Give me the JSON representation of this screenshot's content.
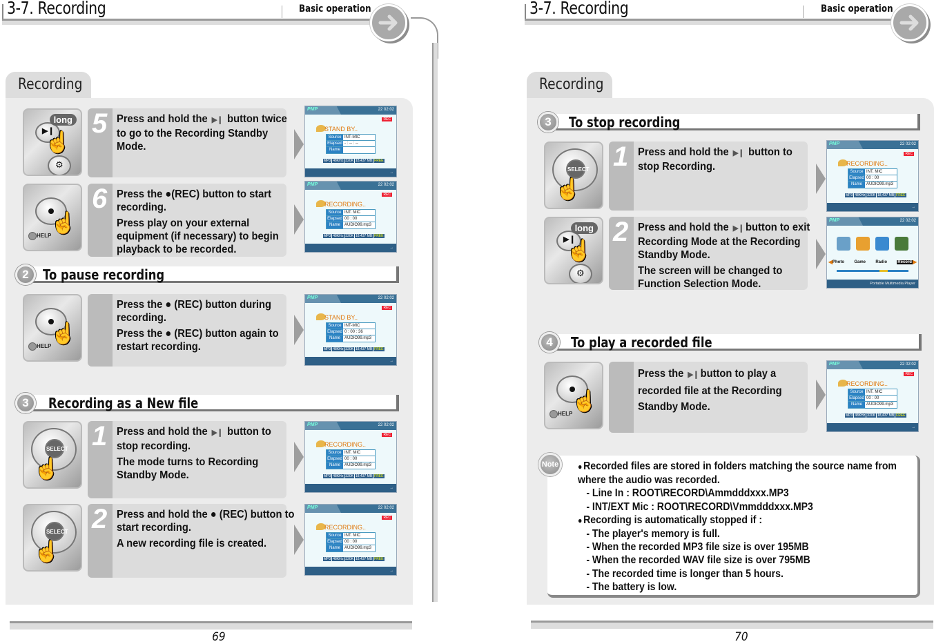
{
  "left_page": {
    "header": {
      "title": "3-7. Recording",
      "section": "Basic operation"
    },
    "tab_label": "Recording",
    "steps_top": [
      {
        "number": "5",
        "device": "play-button-long",
        "device_badge": "long",
        "lines": [
          {
            "pre": "Press and hold the",
            "icon": "play-pause-icon",
            "post": "button twice to go to the Recording Standby Mode."
          }
        ],
        "screen": "standby-empty"
      },
      {
        "number": "6",
        "device": "rec-button",
        "lines": [
          {
            "pre": "Press the",
            "icon": "rec-dot-icon",
            "post": "(REC) button to start recording."
          },
          {
            "pre": "Press play on your external equipment (if necessary) to begin playback to be recorded.",
            "icon": "",
            "post": ""
          }
        ],
        "screen": "recording"
      }
    ],
    "section2": {
      "number": "2",
      "title": "To pause recording",
      "step": {
        "number": "",
        "device": "rec-button",
        "lines": [
          {
            "pre": "Press the",
            "icon": "rec-dot-icon",
            "post": "(REC) button during recording."
          },
          {
            "pre": "Press the",
            "icon": "rec-dot-icon",
            "post": "(REC) button again to restart recording."
          }
        ],
        "screen": "standby-paused"
      }
    },
    "section3": {
      "number": "3",
      "title": "Recording as a New file",
      "steps": [
        {
          "number": "1",
          "device": "select-pad",
          "lines": [
            {
              "pre": "Press and hold the",
              "icon": "play-pause-icon",
              "post": "button to stop recording."
            },
            {
              "pre": "The mode turns to Recording Standby Mode.",
              "icon": "",
              "post": ""
            }
          ],
          "screen": "recording"
        },
        {
          "number": "2",
          "device": "select-pad",
          "lines": [
            {
              "pre": "Press and hold the",
              "icon": "rec-dot-icon",
              "post": "(REC) button to start recording."
            },
            {
              "pre": "A new recording file is created.",
              "icon": "",
              "post": ""
            }
          ],
          "screen": "recording"
        }
      ]
    },
    "page_number": "69"
  },
  "right_page": {
    "header": {
      "title": "3-7. Recording",
      "section": "Basic operation"
    },
    "tab_label": "Recording",
    "section3": {
      "number": "3",
      "title": "To stop recording",
      "steps": [
        {
          "number": "1",
          "device": "select-pad",
          "lines": [
            {
              "pre": "Press and hold the",
              "icon": "play-pause-icon",
              "post": "button to stop Recording."
            }
          ],
          "screen": "recording"
        },
        {
          "number": "2",
          "device": "play-button-long",
          "device_badge": "long",
          "lines": [
            {
              "pre": "Press and hold the",
              "icon": "play-pause-icon",
              "post": "button to exit Recording Mode at the Recording Standby Mode."
            },
            {
              "pre": "The screen will be changed to Function Selection Mode.",
              "icon": "",
              "post": ""
            }
          ],
          "screen": "function-select"
        }
      ]
    },
    "section4": {
      "number": "4",
      "title": "To play a recorded file",
      "step": {
        "number": "",
        "device": "rec-button",
        "lines": [
          {
            "pre": "Press the",
            "icon": "play-pause-icon",
            "post": "button to play a recorded file at the Recording Standby Mode."
          }
        ],
        "screen": "recording"
      }
    },
    "note": {
      "badge": "Note",
      "items": [
        {
          "type": "bullet",
          "text": "Recorded files are stored in folders matching the source name from where the audio was recorded."
        },
        {
          "type": "sub",
          "text": "- Line In : ROOT\\RECORD\\Ammdddxxx.MP3"
        },
        {
          "type": "sub",
          "text": "- INT/EXT Mic :  ROOT\\RECORD\\Vmmdddxxx.MP3"
        },
        {
          "type": "bullet",
          "text": "Recording is automatically stopped if :"
        },
        {
          "type": "sub",
          "text": "- The player's memory is full."
        },
        {
          "type": "sub",
          "text": "- When the recorded MP3 file size is over 195MB"
        },
        {
          "type": "sub",
          "text": "- When the recorded WAV file size is over 795MB"
        },
        {
          "type": "sub",
          "text": "- The recorded time is longer than 5 hours."
        },
        {
          "type": "sub",
          "text": "- The battery is low."
        }
      ]
    },
    "page_number": "70"
  },
  "screens": {
    "standby-empty": {
      "brand": "PMP",
      "status": "22  02:02",
      "rec_badge": "REC",
      "mode": "STAND BY..",
      "fields": [
        {
          "label": "Source",
          "value": "INT-MIC"
        },
        {
          "label": "Elapsed",
          "value": "- : -- : --"
        },
        {
          "label": "Name",
          "value": ""
        }
      ],
      "info": [
        "MP3",
        "48KHz",
        "320K",
        "18,437 MB",
        "FREE"
      ],
      "bottom": "→"
    },
    "standby-paused": {
      "brand": "PMP",
      "status": "22  02:02",
      "rec_badge": "REC",
      "mode": "STAND BY..",
      "fields": [
        {
          "label": "Source",
          "value": "INT-MIC"
        },
        {
          "label": "Elapsed",
          "value": "0 : 00 : 36"
        },
        {
          "label": "Name",
          "value": "AUDIO99.mp3"
        }
      ],
      "info": [
        "MP3",
        "48KHz",
        "320K",
        "18,437 MB",
        "FREE"
      ],
      "bottom": "→"
    },
    "recording": {
      "brand": "PMP",
      "status": "22  02:02",
      "rec_badge": "REC",
      "mode": "RECORDING..",
      "fields": [
        {
          "label": "Source",
          "value": "INT. MIC"
        },
        {
          "label": "Elapsed",
          "value": "00 : 00"
        },
        {
          "label": "Name",
          "value": "AUDIO99.mp3"
        }
      ],
      "info": [
        "MP3",
        "48KHz",
        "320K",
        "18,437 MB",
        "FREE"
      ],
      "bottom": "→"
    },
    "function-select": {
      "brand": "PMP",
      "status": "22  02:02",
      "items": [
        "Photo",
        "Game",
        "Radio",
        "Record"
      ],
      "selected": "Record",
      "bottom": "Portable Multimedia Player"
    }
  },
  "colors": {
    "panel": "#ececec",
    "tab": "#dddddd",
    "screen_bar": "#3a7196",
    "field_label": "#2b82c4",
    "recording_text": "#e07a10"
  }
}
